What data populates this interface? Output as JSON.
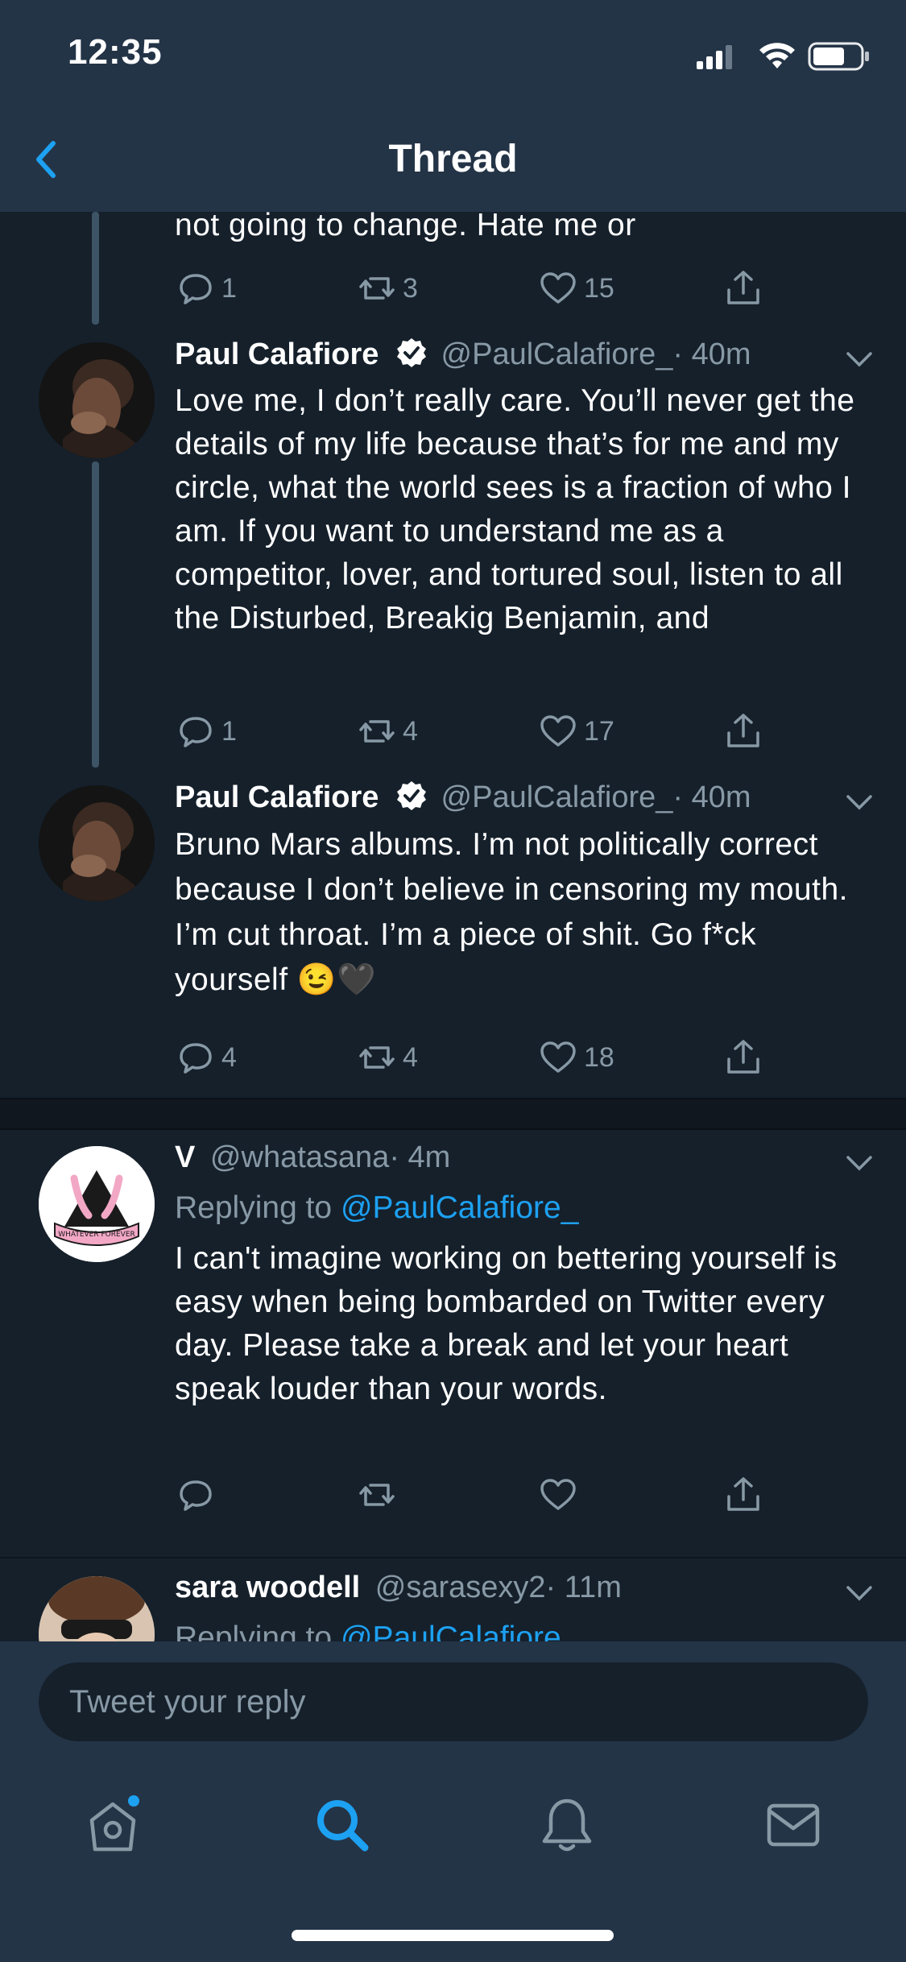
{
  "status": {
    "time": "12:35"
  },
  "nav": {
    "title": "Thread"
  },
  "tweets": [
    {
      "text": "not going to change. Hate me or",
      "stats": {
        "replies": "1",
        "retweets": "3",
        "likes": "15"
      }
    },
    {
      "name": "Paul Calafiore",
      "handle": "@PaulCalafiore_",
      "time": "· 40m",
      "text": "Love me, I don’t really care. You’ll never get the details of my life because that’s for me and my circle, what the world sees is a fraction of who I am. If you want to understand me as a competitor, lover, and tortured soul, listen to all the Disturbed, Breakig Benjamin, and",
      "stats": {
        "replies": "1",
        "retweets": "4",
        "likes": "17"
      }
    },
    {
      "name": "Paul Calafiore",
      "handle": "@PaulCalafiore_",
      "time": "· 40m",
      "text": "Bruno Mars albums. I’m not politically correct because I don’t believe in censoring my mouth. I’m cut throat. I’m a piece of shit. Go f*ck yourself 😉🖤",
      "stats": {
        "replies": "4",
        "retweets": "4",
        "likes": "18"
      }
    },
    {
      "name": "V",
      "handle": "@whatasana",
      "time": "· 4m",
      "replying_label": "Replying to",
      "replying_handle": "@PaulCalafiore_",
      "avatar_text": "WHATEVER FOREVER",
      "text": "I can't imagine working on bettering yourself is easy when being bombarded on Twitter every day. Please take a break and let your heart speak louder than your words.",
      "stats": {
        "replies": "",
        "retweets": "",
        "likes": ""
      }
    },
    {
      "name": "sara woodell",
      "handle": "@sarasexy2",
      "time": "· 11m",
      "replying_label": "Replying to",
      "replying_handle": "@PaulCalafiore_"
    }
  ],
  "reply_box": {
    "placeholder": "Tweet your reply"
  },
  "tabs": [
    "home",
    "search",
    "notifications",
    "messages"
  ],
  "colors": {
    "background": "#15202b",
    "bar": "#243447",
    "accent": "#1da1f2",
    "muted": "#8899a6"
  }
}
